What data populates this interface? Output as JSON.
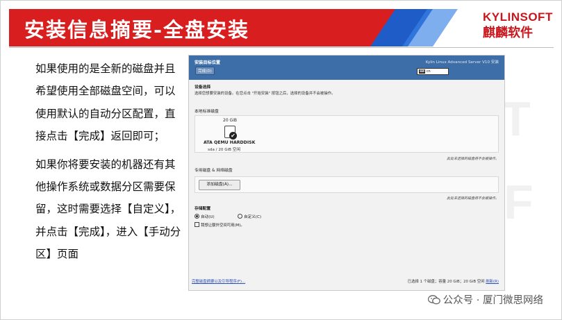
{
  "slide": {
    "title": "安装信息摘要-全盘安装",
    "logo_top": "KYLINSOFT",
    "logo_bottom": "麒麟软件",
    "paragraphs": [
      "如果使用的是全新的磁盘并且希望使用全部磁盘空间，可以使用默认的自动分区配置，直接点击【完成】返回即可；",
      "如果你将要安装的机器还有其他操作系统或数据分区需要保留，这时需要选择【自定义】，并点击【完成】，进入【手动分区】页面"
    ],
    "watermark": "公众号 · 厦门微思网络"
  },
  "installer": {
    "window_title": "安装目标位置",
    "done_button": "完成(D)",
    "product": "Kylin Linux Advanced Server V10 安装",
    "keyboard": "cn",
    "device_selection_heading": "设备选择",
    "device_selection_text": "选择您想要安装的设备。在您点击 \"开始安装\" 按钮之后，选择的设备并不会被操作。",
    "local_disks_heading": "本地标准磁盘",
    "disk": {
      "size": "20 GiB",
      "name": "ATA QEMU HARDDISK",
      "info": "sda  /  20 GiB 空闲"
    },
    "hint1": "此处未选择的磁盘将不会被操作。",
    "special_disks_heading": "专用磁盘 & 网络磁盘",
    "add_disk_button": "添加磁盘(A)...",
    "hint2": "此处未选择的磁盘将不会被操作。",
    "storage_config_heading": "存储配置",
    "radio_auto": "自动(U)",
    "radio_custom": "自定义(C)",
    "checkbox_space": "我想让额外空间可用(M)。",
    "bottom_link": "完整磁盘摘要以及引导程序(F)...",
    "bottom_status": "已选择 1 个磁盘；容量 20 GiB；20 GiB 空闲",
    "refresh_link": "刷新(R)"
  }
}
